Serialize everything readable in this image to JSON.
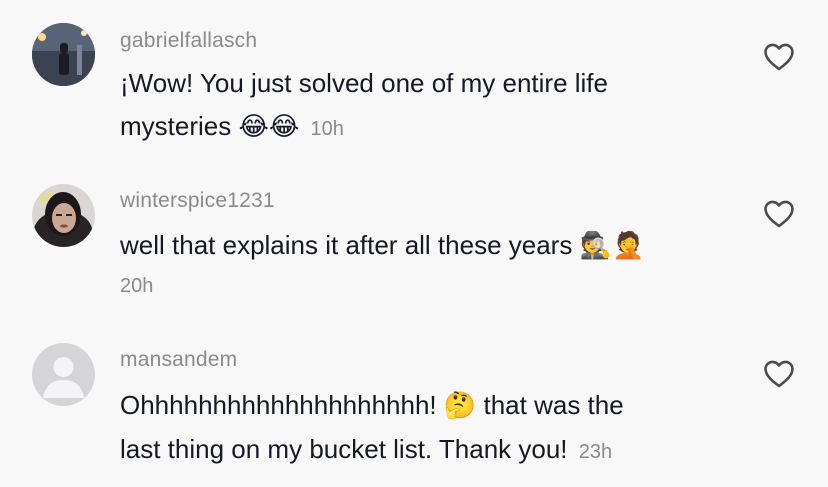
{
  "comments": [
    {
      "username": "gabrielfallasch",
      "text_line1": "¡Wow! You just solved one of my entire life",
      "text_line2": "mysteries",
      "emoji": "😂😂",
      "time": "10h",
      "avatar_icon": "profile-photo-night-street"
    },
    {
      "username": "winterspice1231",
      "text_line1": "well that explains it after all these years",
      "emoji": "🕵️🤦",
      "time": "20h",
      "avatar_icon": "profile-photo-selfie"
    },
    {
      "username": "mansandem",
      "text_line1": "Ohhhhhhhhhhhhhhhhhhhh!",
      "emoji": "🤔",
      "text_line1b": "that was the",
      "text_line2": "last thing on my bucket list. Thank you!",
      "time": "23h",
      "avatar_icon": "default-avatar-icon"
    }
  ],
  "icons": {
    "like": "heart-outline-icon"
  },
  "colors": {
    "background": "#f8f8f8",
    "text": "#161823",
    "muted": "#8a8a8c",
    "icon": "#4a4a4e"
  }
}
